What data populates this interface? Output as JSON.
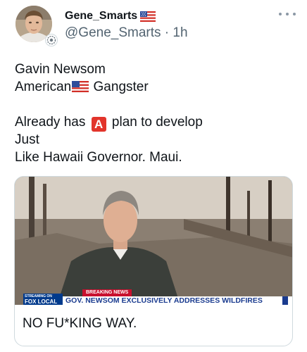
{
  "author": {
    "display_name": "Gene_Smarts",
    "handle": "@Gene_Smarts",
    "separator": " · ",
    "time": "1h",
    "name_emoji": "us-flag-icon"
  },
  "tweet": {
    "line1": "Gavin Newsom",
    "line2_before": "American",
    "line2_after": " Gangster",
    "line3_before": "Already has ",
    "line3_button": "A",
    "line3_after": " plan to develop",
    "line4": "Just",
    "line5": "Like Hawaii Governor.  Maui."
  },
  "card": {
    "breaking_label": "BREAKING NEWS",
    "network_top": "STREAMING ON",
    "network_name": "FOX LOCAL",
    "headline": "GOV. NEWSOM EXCLUSIVELY ADDRESSES WILDFIRES",
    "caption": "NO FU*KING WAY."
  },
  "colors": {
    "text": "#0f1419",
    "secondary": "#536471",
    "border": "#cfd9de",
    "a_button": "#e2342b",
    "chyron_blue": "#1a3b8f",
    "breaking_red": "#c8102e"
  }
}
